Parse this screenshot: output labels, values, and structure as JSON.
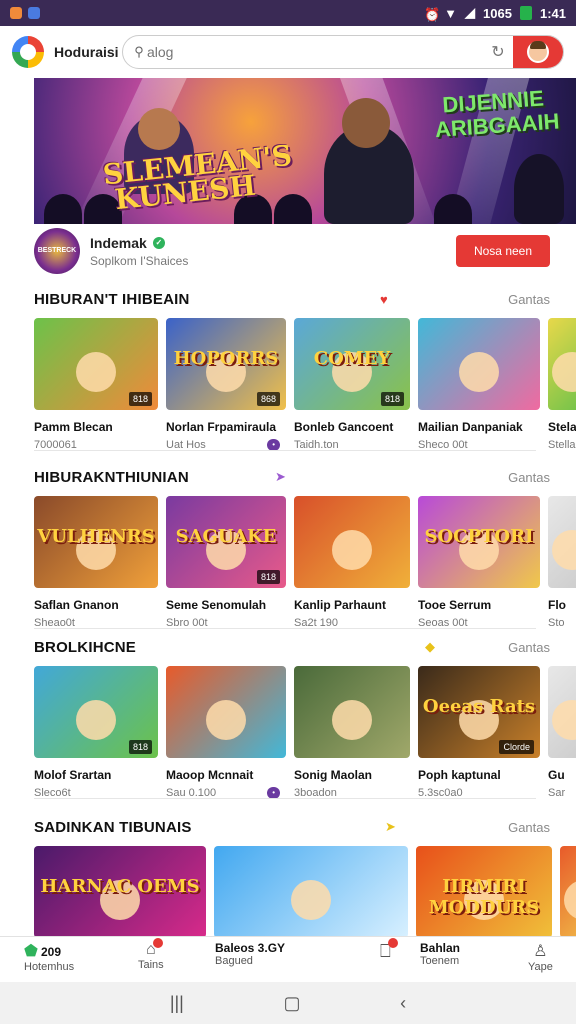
{
  "status_bar": {
    "time": "1:41",
    "indicators": "1065",
    "colors": {
      "bg": "#3a2a55",
      "battery": "#26b24b"
    }
  },
  "top_bar": {
    "app_name": "Hoduraisi",
    "search_placeholder": "alog",
    "icons": [
      "app-logo",
      "search-icon",
      "refresh-icon",
      "avatar-icon"
    ],
    "accent": "#e53935"
  },
  "banner": {
    "title_left": "SLEMEAN'S KUNESH",
    "title_right": "DIJENNIE ARIBGAAIH"
  },
  "channel": {
    "name": "Indemak",
    "subtitle": "Soplkom I'Shaices",
    "logo_text": "BESTRECK",
    "follow_label": "Nosa neen"
  },
  "sections": [
    {
      "title": "HIBURAN'T IHIBEAIN",
      "more": "Gantas",
      "tiles": [
        {
          "thumb_text": "",
          "badge": "818",
          "title": "Pamm Blecan",
          "sub": "7000061",
          "tag": ""
        },
        {
          "thumb_text": "HOPORRS",
          "badge": "868",
          "title": "Norlan Frpamiraula",
          "sub": "Uat Hos",
          "tag": "•"
        },
        {
          "thumb_text": "COMEY",
          "badge": "818",
          "title": "Bonleb Gancoent",
          "sub": "Taidh.ton",
          "tag": ""
        },
        {
          "thumb_text": "",
          "badge": "",
          "title": "Mailian Danpaniak",
          "sub": "Sheco 00t",
          "tag": ""
        },
        {
          "thumb_text": "",
          "badge": "",
          "title": "Stelan",
          "sub": "Stella",
          "tag": ""
        }
      ]
    },
    {
      "title": "HIBURAKNTHIUNIAN",
      "more": "Gantas",
      "tiles": [
        {
          "thumb_text": "VULHENRS",
          "badge": "",
          "title": "Saflan Gnanon",
          "sub": "Sheao0t",
          "tag": ""
        },
        {
          "thumb_text": "SAGUAKE",
          "badge": "818",
          "title": "Seme Senomulah",
          "sub": "Sbro 00t",
          "tag": ""
        },
        {
          "thumb_text": "",
          "badge": "",
          "title": "Kanlip Parhaunt",
          "sub": "Sa2t 190",
          "tag": ""
        },
        {
          "thumb_text": "SOCPTORI",
          "badge": "",
          "title": "Tooe Serrum",
          "sub": "Seoas 00t",
          "tag": ""
        },
        {
          "thumb_text": "",
          "badge": "",
          "title": "Flo",
          "sub": "Sto",
          "tag": ""
        }
      ]
    },
    {
      "title": "BROLKIHCNE",
      "more": "Gantas",
      "tiles": [
        {
          "thumb_text": "",
          "badge": "818",
          "title": "Molof Srartan",
          "sub": "Sleco6t",
          "tag": ""
        },
        {
          "thumb_text": "",
          "badge": "",
          "title": "Maoop Mcnnait",
          "sub": "Sau 0.100",
          "tag": "•"
        },
        {
          "thumb_text": "",
          "badge": "",
          "title": "Sonig Maolan",
          "sub": "3boadon",
          "tag": ""
        },
        {
          "thumb_text": "Oeeas Rats",
          "badge": "Clorde",
          "title": "Poph kaptunal",
          "sub": "5.3sc0a0",
          "tag": ""
        },
        {
          "thumb_text": "",
          "badge": "",
          "title": "Gu",
          "sub": "Sar",
          "tag": ""
        }
      ]
    },
    {
      "title": "SADINKAN TIBUNAIS",
      "more": "Gantas",
      "tiles": [
        {
          "thumb_text": "HARNAC OEMS",
          "badge": "",
          "title": "",
          "sub": "",
          "tag": ""
        },
        {
          "thumb_text": "",
          "badge": "",
          "title": "",
          "sub": "",
          "tag": ""
        },
        {
          "thumb_text": "IIRMIRI MODDURS",
          "badge": "",
          "title": "",
          "sub": "",
          "tag": ""
        },
        {
          "thumb_text": "",
          "badge": "",
          "title": "",
          "sub": "",
          "tag": ""
        }
      ]
    }
  ],
  "bottom_nav": [
    {
      "top": "209",
      "label": "Hotemhus",
      "icon": "home-icon"
    },
    {
      "top": "",
      "label": "Tains",
      "icon": "gift-icon"
    },
    {
      "top": "Baleos 3.GY",
      "label": "Bagued",
      "icon": ""
    },
    {
      "top": "",
      "label": "",
      "icon": "bookmark-icon"
    },
    {
      "top": "Bahlan",
      "label": "Toenem",
      "icon": ""
    },
    {
      "top": "",
      "label": "Yape",
      "icon": "profile-icon"
    }
  ],
  "system_nav": {
    "recents": "|||",
    "home": "▢",
    "back": "‹"
  }
}
